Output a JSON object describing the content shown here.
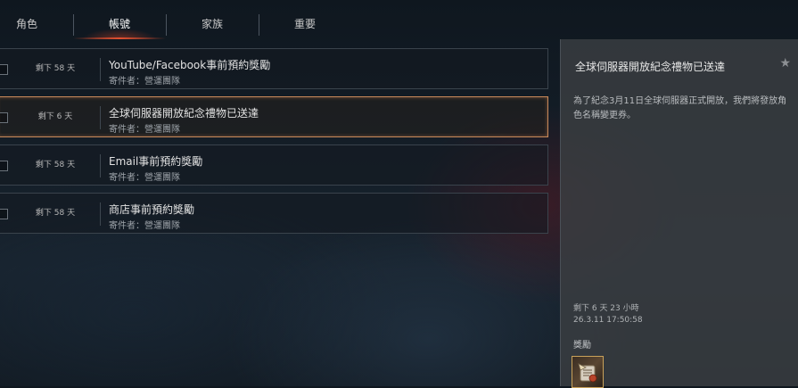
{
  "tabs": [
    {
      "label": "角色"
    },
    {
      "label": "帳號"
    },
    {
      "label": "家族"
    },
    {
      "label": "重要"
    }
  ],
  "mails": [
    {
      "remain": "剩下 58 天",
      "title": "YouTube/Facebook事前預約獎勵",
      "sender": "寄件者：營運團隊"
    },
    {
      "remain": "剩下 6 天",
      "title": "全球伺服器開放紀念禮物已送達",
      "sender": "寄件者：營運團隊"
    },
    {
      "remain": "剩下 58 天",
      "title": "Email事前預約獎勵",
      "sender": "寄件者：營運團隊"
    },
    {
      "remain": "剩下 58 天",
      "title": "商店事前預約獎勵",
      "sender": "寄件者：營運團隊"
    }
  ],
  "detail": {
    "title": "全球伺服器開放紀念禮物已送達",
    "star_icon": "★",
    "body": "為了紀念3月11日全球伺服器正式開放，我們將發放角色名稱變更券。",
    "remain": "剩下 6 天 23 小時",
    "date": "26.3.11 17:50:58",
    "reward_label": "獎勵",
    "reward_icon": "name-change-ticket-icon"
  },
  "colors": {
    "selected_border": "#c8895a",
    "tab_underline": "#e05030",
    "reward_border": "#c9a25a"
  }
}
